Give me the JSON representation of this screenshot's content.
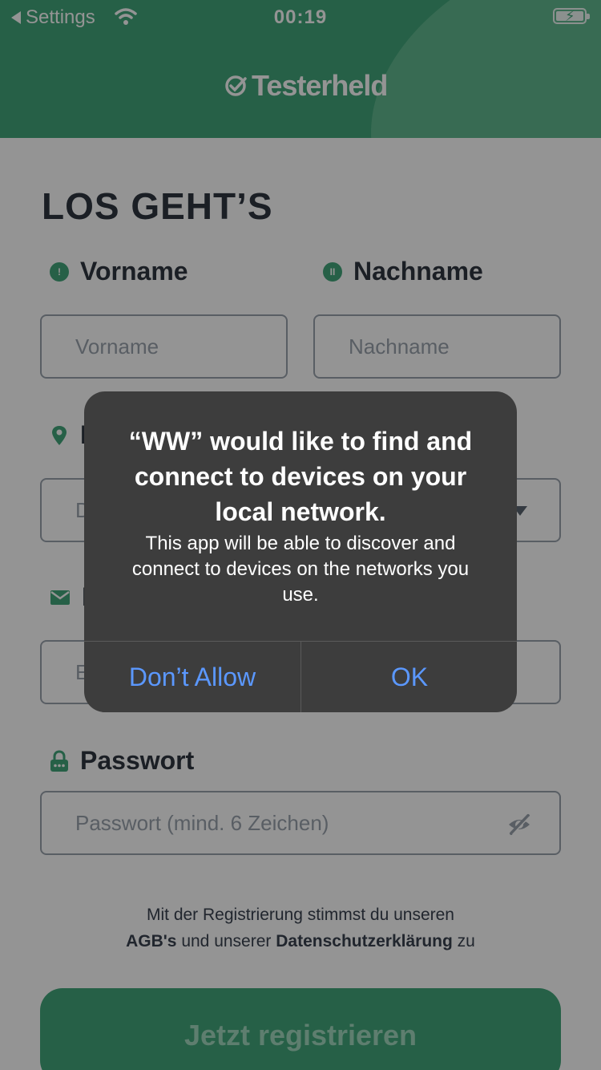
{
  "status_bar": {
    "back_label": "Settings",
    "time": "00:19"
  },
  "brand": {
    "name": "Testerheld"
  },
  "form": {
    "title": "LOS GEHT’S",
    "first_name": {
      "label": "Vorname",
      "placeholder": "Vorname"
    },
    "last_name": {
      "label": "Nachname",
      "placeholder": "Nachname"
    },
    "location": {
      "label_visible": "L",
      "value_visible": "D"
    },
    "email": {
      "label_visible": "E",
      "placeholder_visible": "E"
    },
    "password": {
      "label": "Passwort",
      "placeholder": "Passwort (mind. 6 Zeichen)"
    },
    "terms": {
      "line1": "Mit der Registrierung stimmst du unseren",
      "agb": "AGB's",
      "middle": "und unserer",
      "privacy": "Datenschutzerklärung",
      "end": "zu"
    },
    "submit_label": "Jetzt registrieren"
  },
  "alert": {
    "title": "“WW” would like to find and connect to devices on your local network.",
    "message": "This app will be able to discover and connect to devices on the networks you use.",
    "deny_label": "Don’t Allow",
    "ok_label": "OK"
  },
  "colors": {
    "brand_green": "#42a67a",
    "alert_bg": "#3d3d3d",
    "link_blue": "#5b98ff"
  }
}
